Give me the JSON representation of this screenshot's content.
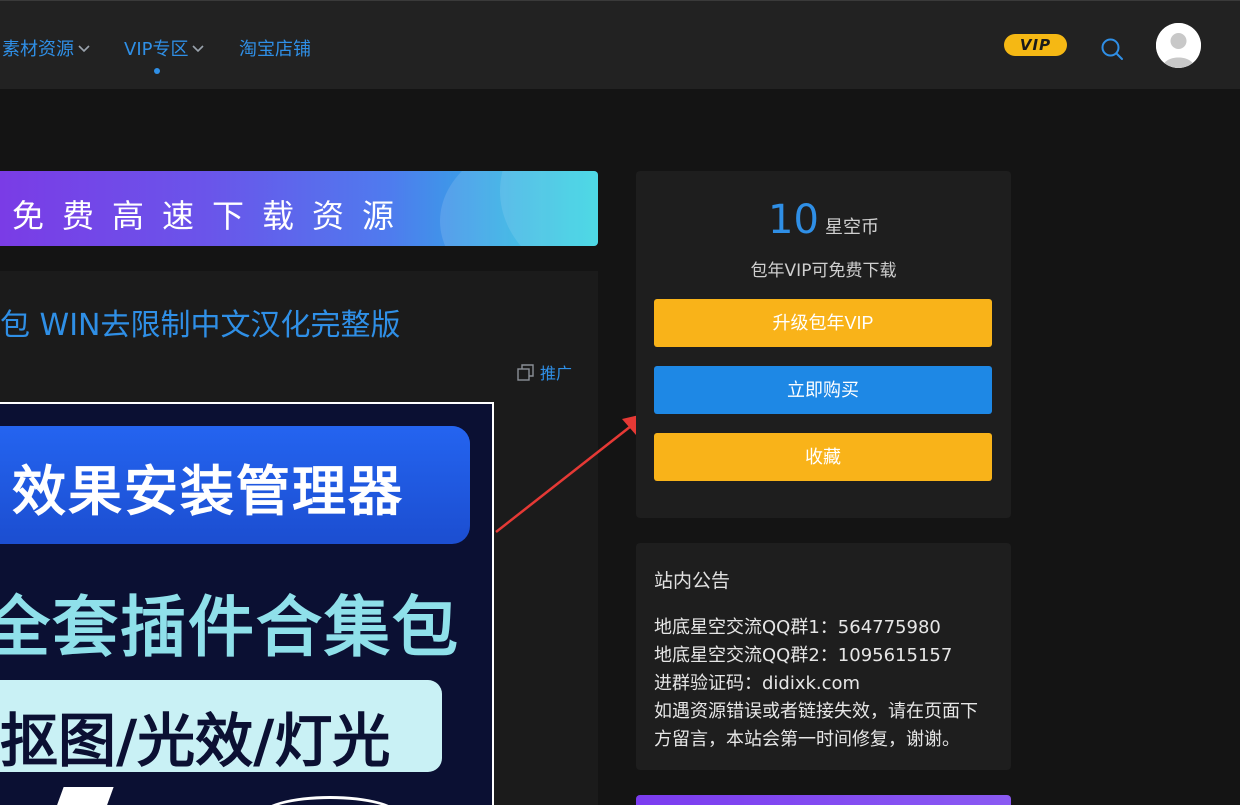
{
  "header": {
    "nav": [
      {
        "label": "素材资源",
        "has_dropdown": true
      },
      {
        "label": "VIP专区",
        "has_dropdown": true,
        "active": true
      },
      {
        "label": "淘宝店铺",
        "has_dropdown": false
      }
    ],
    "vip_badge": "VIP",
    "icons": {
      "search": "search-icon",
      "avatar": "user-avatar-icon",
      "chevron": "chevron-down-icon"
    }
  },
  "banner": {
    "text": "免费高速下载资源"
  },
  "post": {
    "title": "包 WIN去限制中文汉化完整版",
    "promote_label": "推广",
    "image_text": {
      "line1": "效果安装管理器",
      "line2": "全套插件合集包",
      "line3": "抠图/光效/灯光"
    }
  },
  "buy": {
    "price": "10",
    "unit": "星空币",
    "note": "包年VIP可免费下载",
    "upgrade_label": "升级包年VIP",
    "buy_label": "立即购买",
    "favorite_label": "收藏"
  },
  "notice": {
    "title": "站内公告",
    "lines": [
      "地底星空交流QQ群1：564775980",
      "地底星空交流QQ群2：1095615157",
      "进群验证码：didixk.com",
      "如遇资源错误或者链接失效，请在页面下",
      "方留言，本站会第一时间修复，谢谢。"
    ]
  },
  "colors": {
    "accent": "#2f8fe6",
    "vip_gold": "#f5b814",
    "button_yellow": "#f9b319",
    "button_blue": "#1e88e5",
    "background": "#141414",
    "panel": "#1e1e1e",
    "arrow_red": "#e53935"
  }
}
